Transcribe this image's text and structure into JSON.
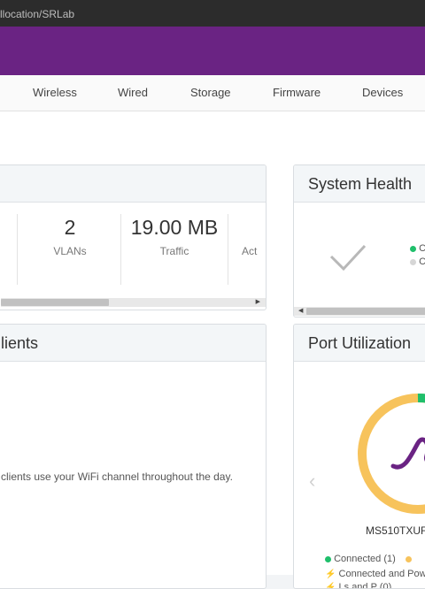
{
  "browser": {
    "url_fragment": "llocation/SRLab"
  },
  "nav": {
    "items": [
      {
        "label": "Wireless"
      },
      {
        "label": "Wired"
      },
      {
        "label": "Storage"
      },
      {
        "label": "Firmware"
      },
      {
        "label": "Devices"
      }
    ]
  },
  "summary_card": {
    "stats": [
      {
        "value": "2",
        "label": "VLANs"
      },
      {
        "value": "19.00 MB",
        "label": "Traffic"
      },
      {
        "value": "",
        "label": "Act"
      }
    ]
  },
  "clients_card": {
    "title": "lients",
    "description": "clients use your WiFi channel throughout the day."
  },
  "system_health": {
    "title": "System Health",
    "legend": [
      {
        "label": "C",
        "color": "#1fbf6b"
      },
      {
        "label": "C",
        "color": "#d6d6d6"
      }
    ]
  },
  "port_utilization": {
    "title": "Port Utilization",
    "device_name": "MS510TXUF",
    "legend_connected": "Connected (1)",
    "legend_powered": "Connected and Powe",
    "legend_partial": "Ls and P (0)",
    "colors": {
      "connected": "#1fbf6b",
      "available": "#f7c35c",
      "accent": "#6a2383"
    }
  },
  "colors": {
    "brand": "#6a2383",
    "card_header": "#f3f6f8"
  }
}
